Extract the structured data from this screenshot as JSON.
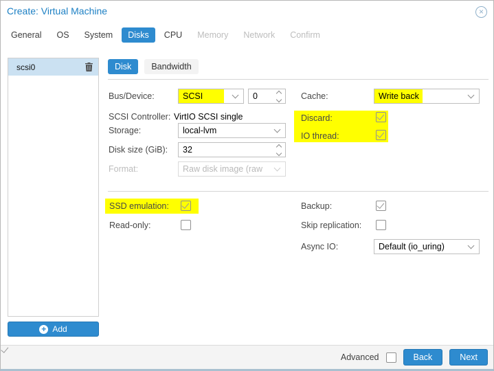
{
  "window": {
    "title": "Create: Virtual Machine"
  },
  "icons": {
    "close": "circle-x",
    "delete": "trash",
    "add": "plus-circle",
    "dropdown": "chevron-down",
    "spinner": "up-down-chevrons"
  },
  "colors": {
    "accent": "#2e8bcf",
    "highlight": "#ffff00",
    "selected_row_bg": "#cbe1f2",
    "title_text": "#1d80c4",
    "footer_bg": "#f4f4f4"
  },
  "tabs": [
    {
      "label": "General",
      "state": "normal"
    },
    {
      "label": "OS",
      "state": "normal"
    },
    {
      "label": "System",
      "state": "normal"
    },
    {
      "label": "Disks",
      "state": "active"
    },
    {
      "label": "CPU",
      "state": "normal"
    },
    {
      "label": "Memory",
      "state": "disabled"
    },
    {
      "label": "Network",
      "state": "disabled"
    },
    {
      "label": "Confirm",
      "state": "disabled"
    }
  ],
  "sidebar": {
    "items": [
      {
        "label": "scsi0",
        "selected": true
      }
    ],
    "add_button": "Add"
  },
  "subtabs": [
    {
      "label": "Disk",
      "state": "active"
    },
    {
      "label": "Bandwidth",
      "state": "normal"
    }
  ],
  "form": {
    "bus_device": {
      "label": "Bus/Device:",
      "value": "SCSI",
      "index": "0",
      "highlighted": true
    },
    "scsi_controller": {
      "label": "SCSI Controller:",
      "value": "VirtIO SCSI single"
    },
    "storage": {
      "label": "Storage:",
      "value": "local-lvm"
    },
    "disk_size": {
      "label": "Disk size (GiB):",
      "value": "32"
    },
    "format": {
      "label": "Format:",
      "value": "Raw disk image (raw",
      "disabled": true
    },
    "cache": {
      "label": "Cache:",
      "value": "Write back",
      "highlighted": true
    },
    "discard": {
      "label": "Discard:",
      "checked": true,
      "highlighted": true
    },
    "io_thread": {
      "label": "IO thread:",
      "checked": true,
      "highlighted": true
    },
    "ssd_emulation": {
      "label": "SSD emulation:",
      "checked": true,
      "highlighted": true
    },
    "read_only": {
      "label": "Read-only:",
      "checked": false
    },
    "backup": {
      "label": "Backup:",
      "checked": true
    },
    "skip_replication": {
      "label": "Skip replication:",
      "checked": false
    },
    "async_io": {
      "label": "Async IO:",
      "value": "Default (io_uring)"
    }
  },
  "footer": {
    "advanced_label": "Advanced",
    "advanced_checked": true,
    "back_button": "Back",
    "next_button": "Next"
  }
}
